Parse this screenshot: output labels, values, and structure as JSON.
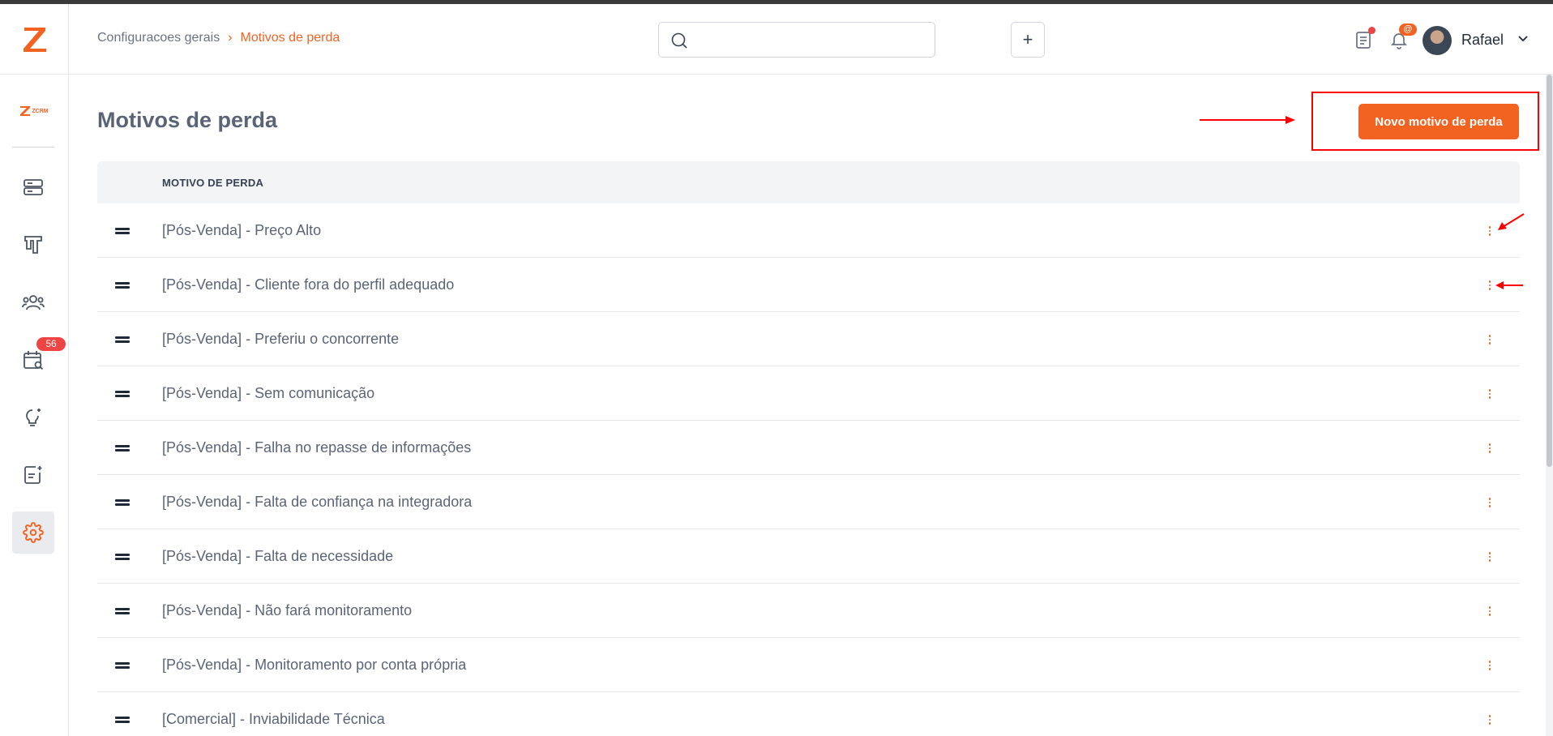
{
  "header": {
    "breadcrumb": {
      "root": "Configuracoes gerais",
      "separator": "›",
      "current": "Motivos de perda"
    },
    "search": {
      "value": "",
      "placeholder": ""
    },
    "add_label": "+",
    "user": {
      "name": "Rafael"
    },
    "mention_badge": "@"
  },
  "sidebar": {
    "logo_icon": "z-logo-icon",
    "brand": "ZCRM",
    "items": [
      {
        "icon": "server-icon"
      },
      {
        "icon": "kanban-icon"
      },
      {
        "icon": "users-icon"
      },
      {
        "icon": "calendar-search-icon",
        "badge": "56"
      },
      {
        "icon": "lightbulb-icon"
      },
      {
        "icon": "notes-icon"
      },
      {
        "icon": "gear-icon",
        "active": true
      }
    ]
  },
  "main": {
    "title": "Motivos de perda",
    "new_button": "Novo motivo de perda",
    "column_header": "MOTIVO DE PERDA",
    "rows": [
      "[Pós-Venda] - Preço Alto",
      "[Pós-Venda] - Cliente fora do perfil adequado",
      "[Pós-Venda] - Preferiu o concorrente",
      "[Pós-Venda] - Sem comunicação",
      "[Pós-Venda] - Falha no repasse de informações",
      "[Pós-Venda] - Falta de confiança na integradora",
      "[Pós-Venda] - Falta de necessidade",
      "[Pós-Venda] - Não fará monitoramento",
      "[Pós-Venda] - Monitoramento por conta própria",
      "[Comercial] - Inviabilidade Técnica"
    ]
  },
  "colors": {
    "accent": "#f26322",
    "annotation": "#ff0000",
    "badge": "#ef4444"
  }
}
